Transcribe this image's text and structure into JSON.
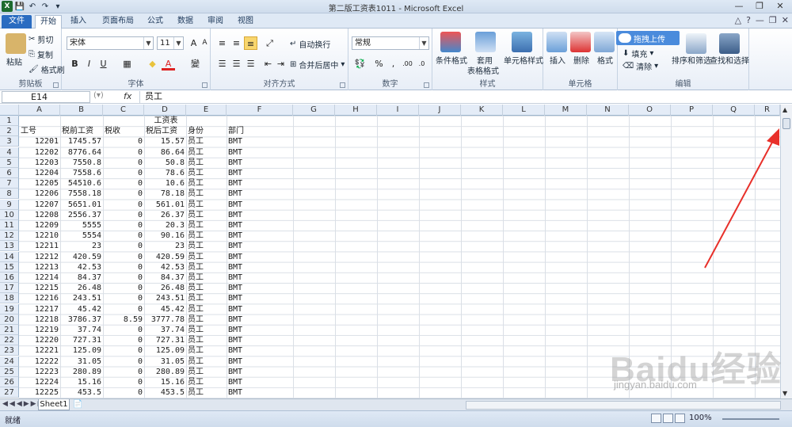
{
  "app": {
    "window_title": "第二版工资表1011 - Microsoft Excel",
    "logo_letter": "X"
  },
  "tabs": [
    "文件",
    "开始",
    "插入",
    "页面布局",
    "公式",
    "数据",
    "审阅",
    "视图"
  ],
  "ribbon": {
    "clipboard": {
      "label": "剪贴板",
      "paste": "粘贴",
      "cut": "剪切",
      "copy": "复制",
      "format_painter": "格式刷"
    },
    "font": {
      "label": "字体",
      "font_name": "宋体",
      "font_size": "11",
      "bold": "B",
      "italic": "I",
      "underline": "U",
      "font_color_letter": "A"
    },
    "alignment": {
      "label": "对齐方式",
      "wrap": "自动换行",
      "merge": "合并后居中"
    },
    "number": {
      "label": "数字",
      "format": "常规",
      "percent": "%"
    },
    "styles": {
      "label": "样式",
      "conditional": "条件格式",
      "table": "套用",
      "table2": "表格格式",
      "cell_styles": "单元格样式"
    },
    "cells": {
      "label": "单元格",
      "insert": "插入",
      "delete": "删除",
      "format": "格式"
    },
    "editing": {
      "label": "编辑",
      "fill": "填充",
      "clear": "清除",
      "sort_filter": "排序和筛选",
      "find_select": "查找和选择",
      "upload": "拖拽上传"
    }
  },
  "formula_bar": {
    "name_box": "E14",
    "fx": "fx",
    "content": "员工"
  },
  "columns": [
    "A",
    "B",
    "C",
    "D",
    "E",
    "F",
    "G",
    "H",
    "I",
    "J",
    "K",
    "L",
    "M",
    "N",
    "O",
    "P",
    "Q",
    "R"
  ],
  "rows": [
    {
      "n": "1",
      "a": "",
      "b": "",
      "c": "",
      "d": "工资表",
      "e": "",
      "f": ""
    },
    {
      "n": "2",
      "a": "工号",
      "b": "税前工资",
      "c": "税收",
      "d": "税后工资",
      "e": "身份",
      "f": "部门"
    },
    {
      "n": "3",
      "a": "12201",
      "b": "1745.57",
      "c": "0",
      "d": "15.57",
      "e": "员工",
      "f": "BMT"
    },
    {
      "n": "4",
      "a": "12202",
      "b": "8776.64",
      "c": "0",
      "d": "86.64",
      "e": "员工",
      "f": "BMT"
    },
    {
      "n": "5",
      "a": "12203",
      "b": "7550.8",
      "c": "0",
      "d": "50.8",
      "e": "员工",
      "f": "BMT"
    },
    {
      "n": "6",
      "a": "12204",
      "b": "7558.6",
      "c": "0",
      "d": "78.6",
      "e": "员工",
      "f": "BMT"
    },
    {
      "n": "7",
      "a": "12205",
      "b": "54510.6",
      "c": "0",
      "d": "10.6",
      "e": "员工",
      "f": "BMT"
    },
    {
      "n": "8",
      "a": "12206",
      "b": "7558.18",
      "c": "0",
      "d": "78.18",
      "e": "员工",
      "f": "BMT"
    },
    {
      "n": "9",
      "a": "12207",
      "b": "5651.01",
      "c": "0",
      "d": "561.01",
      "e": "员工",
      "f": "BMT"
    },
    {
      "n": "10",
      "a": "12208",
      "b": "2556.37",
      "c": "0",
      "d": "26.37",
      "e": "员工",
      "f": "BMT"
    },
    {
      "n": "11",
      "a": "12209",
      "b": "5555",
      "c": "0",
      "d": "20.3",
      "e": "员工",
      "f": "BMT"
    },
    {
      "n": "12",
      "a": "12210",
      "b": "5554",
      "c": "0",
      "d": "90.16",
      "e": "员工",
      "f": "BMT"
    },
    {
      "n": "13",
      "a": "12211",
      "b": "23",
      "c": "0",
      "d": "23",
      "e": "员工",
      "f": "BMT"
    },
    {
      "n": "14",
      "a": "12212",
      "b": "420.59",
      "c": "0",
      "d": "420.59",
      "e": "员工",
      "f": "BMT"
    },
    {
      "n": "15",
      "a": "12213",
      "b": "42.53",
      "c": "0",
      "d": "42.53",
      "e": "员工",
      "f": "BMT"
    },
    {
      "n": "16",
      "a": "12214",
      "b": "84.37",
      "c": "0",
      "d": "84.37",
      "e": "员工",
      "f": "BMT"
    },
    {
      "n": "17",
      "a": "12215",
      "b": "26.48",
      "c": "0",
      "d": "26.48",
      "e": "员工",
      "f": "BMT"
    },
    {
      "n": "18",
      "a": "12216",
      "b": "243.51",
      "c": "0",
      "d": "243.51",
      "e": "员工",
      "f": "BMT"
    },
    {
      "n": "19",
      "a": "12217",
      "b": "45.42",
      "c": "0",
      "d": "45.42",
      "e": "员工",
      "f": "BMT"
    },
    {
      "n": "20",
      "a": "12218",
      "b": "3786.37",
      "c": "8.59",
      "d": "3777.78",
      "e": "员工",
      "f": "BMT"
    },
    {
      "n": "21",
      "a": "12219",
      "b": "37.74",
      "c": "0",
      "d": "37.74",
      "e": "员工",
      "f": "BMT"
    },
    {
      "n": "22",
      "a": "12220",
      "b": "727.31",
      "c": "0",
      "d": "727.31",
      "e": "员工",
      "f": "BMT"
    },
    {
      "n": "23",
      "a": "12221",
      "b": "125.09",
      "c": "0",
      "d": "125.09",
      "e": "员工",
      "f": "BMT"
    },
    {
      "n": "24",
      "a": "12222",
      "b": "31.05",
      "c": "0",
      "d": "31.05",
      "e": "员工",
      "f": "BMT"
    },
    {
      "n": "25",
      "a": "12223",
      "b": "280.89",
      "c": "0",
      "d": "280.89",
      "e": "员工",
      "f": "BMT"
    },
    {
      "n": "26",
      "a": "12224",
      "b": "15.16",
      "c": "0",
      "d": "15.16",
      "e": "员工",
      "f": "BMT"
    },
    {
      "n": "27",
      "a": "12225",
      "b": "453.5",
      "c": "0",
      "d": "453.5",
      "e": "员工",
      "f": "BMT"
    }
  ],
  "sheet_tabs": [
    "Sheet1"
  ],
  "status": {
    "ready": "就绪",
    "zoom": "100%"
  },
  "watermark": {
    "brand": "Baidu经验",
    "url": "jingyan.baidu.com"
  },
  "colors": {
    "accent": "#2a6cc1",
    "arrow": "#e8302a"
  }
}
